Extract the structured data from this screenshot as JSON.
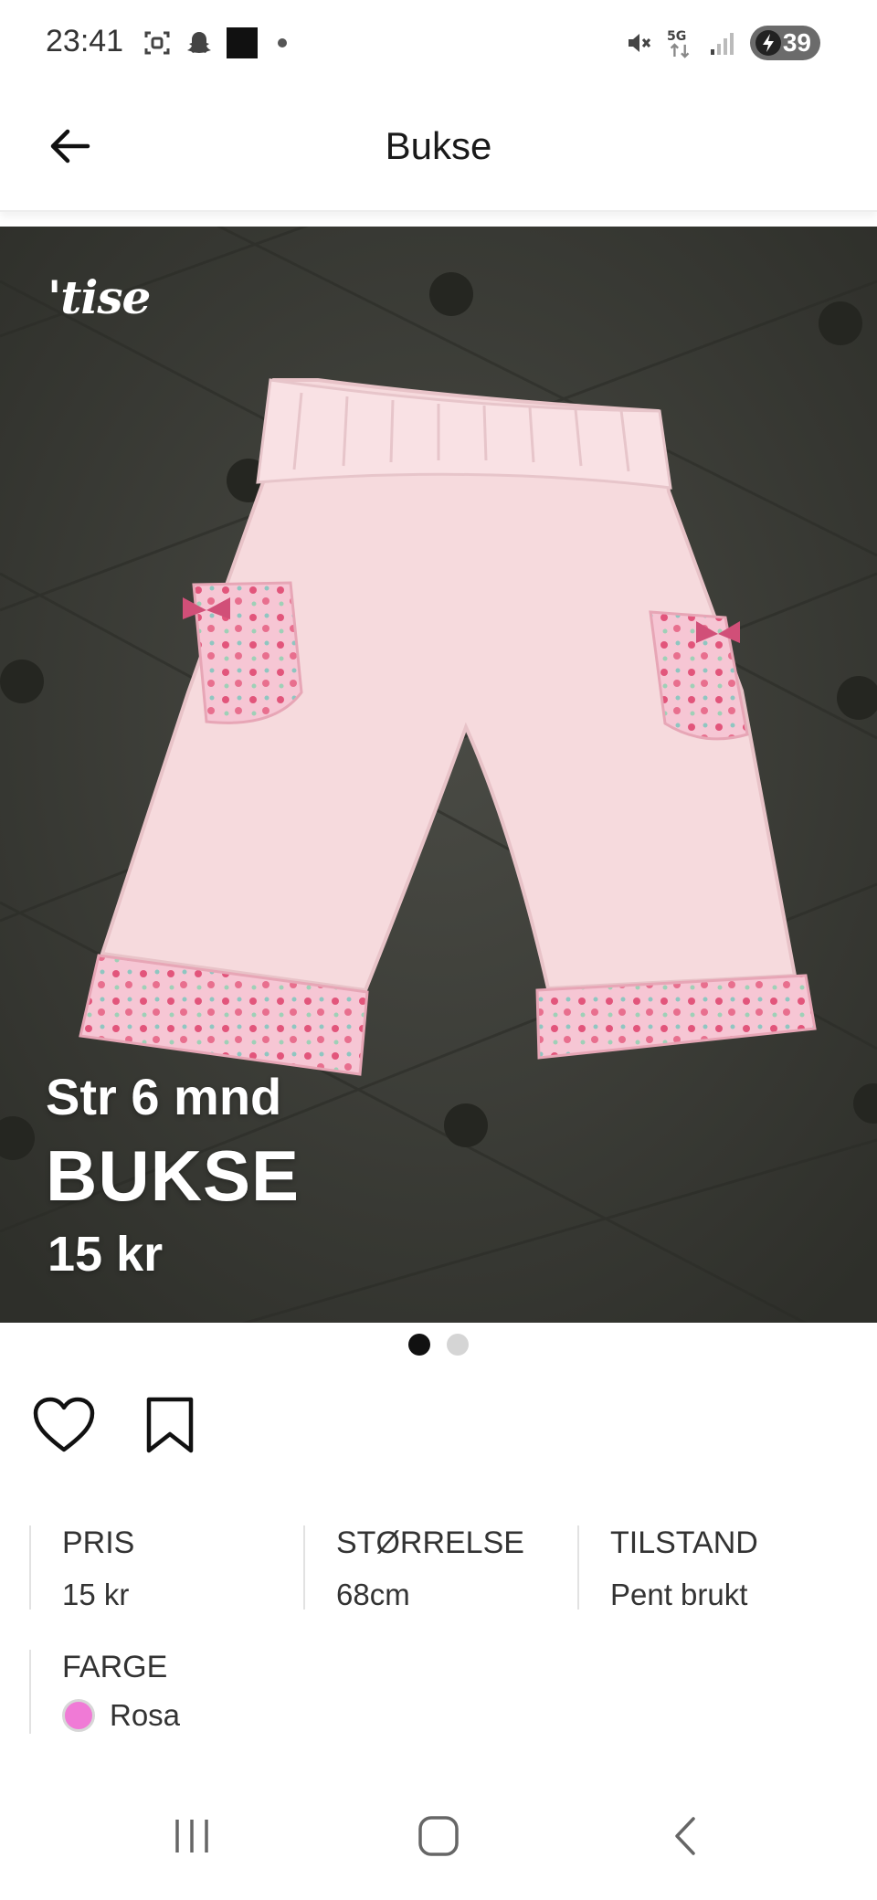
{
  "status_bar": {
    "time": "23:41",
    "battery": "39",
    "network": "5G",
    "icons_left": [
      "screenshot-icon",
      "snapchat-icon",
      "app-thumbnail-icon",
      "notification-dot-icon"
    ],
    "icons_right": [
      "mute-icon",
      "5g-icon",
      "signal-icon",
      "battery-icon"
    ]
  },
  "header": {
    "title": "Bukse",
    "back_icon": "arrow-left-icon"
  },
  "photo": {
    "brand": "'tise",
    "overlay_size": "Str 6 mnd",
    "overlay_title": "BUKSE",
    "overlay_price": "15 kr",
    "page_count": 2,
    "active_page": 1
  },
  "actions": {
    "like_icon": "heart-icon",
    "save_icon": "bookmark-icon"
  },
  "details": {
    "price_label": "PRIS",
    "price_value": "15 kr",
    "size_label": "STØRRELSE",
    "size_value": "68cm",
    "condition_label": "TILSTAND",
    "condition_value": "Pent brukt",
    "color_label": "FARGE",
    "color_value": "Rosa",
    "color_hex": "#f07ad6"
  },
  "nav": {
    "recent_icon": "recent-apps-icon",
    "home_icon": "home-icon",
    "back_icon": "back-chevron-icon"
  },
  "colors": {
    "background": "#ffffff",
    "photo_bg": "#3b3c36",
    "text": "#222222"
  }
}
